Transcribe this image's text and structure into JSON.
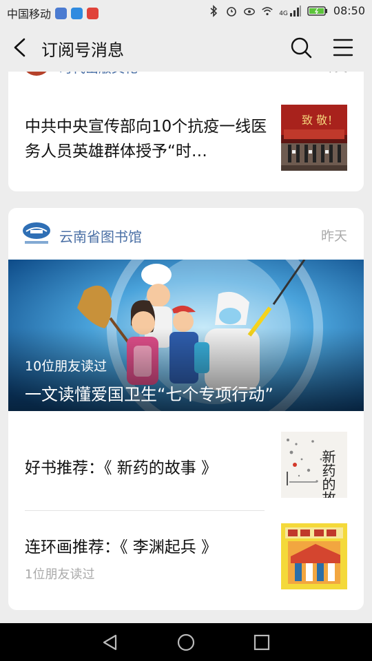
{
  "status_bar": {
    "carrier": "中国移动",
    "network": "4G",
    "time": "08:50"
  },
  "header": {
    "title": "订阅号消息"
  },
  "card1": {
    "publisher": "时代出版文化",
    "time": "昨天",
    "article_title": "中共中央宣传部向10个抗疫一线医务人员英雄群体授予“时…"
  },
  "card2": {
    "publisher": "云南省图书馆",
    "time": "昨天",
    "hero": {
      "friends_read": "10位朋友读过",
      "title": "一文读懂爱国卫生“七个专项行动”"
    },
    "items": [
      {
        "title": "好书推荐：《 新药的故事 》",
        "sub": ""
      },
      {
        "title": "连环画推荐：《 李渊起兵 》",
        "sub": "1位朋友读过"
      }
    ]
  },
  "thumbs": {
    "book_cover_text": "新药的故"
  }
}
